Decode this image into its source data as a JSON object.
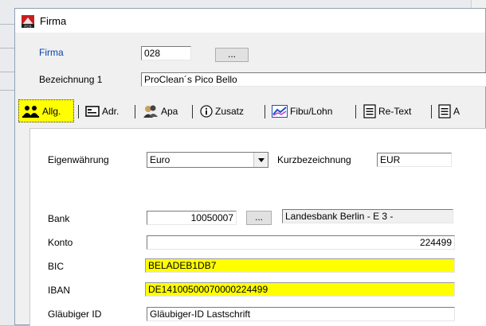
{
  "window": {
    "title": "Firma",
    "icon": "fcs-app-icon"
  },
  "header": {
    "firma_label": "Firma",
    "firma_value": "028",
    "lookup_button": "...",
    "bezeichnung_label": "Bezeichnung 1",
    "bezeichnung_value": "ProClean´s Pico Bello"
  },
  "tabs": [
    {
      "label": "Allg.",
      "icon": "people-icon",
      "active": true
    },
    {
      "label": "Adr.",
      "icon": "address-card-icon"
    },
    {
      "label": "Apa",
      "icon": "contacts-icon"
    },
    {
      "label": "Zusatz",
      "icon": "info-icon"
    },
    {
      "label": "Fibu/Lohn",
      "icon": "chart-icon"
    },
    {
      "label": "Re-Text",
      "icon": "document-icon"
    },
    {
      "label": "A",
      "icon": "document-icon"
    }
  ],
  "allg": {
    "eigenwaehrung_label": "Eigenwährung",
    "eigenwaehrung_value": "Euro",
    "kurzbezeichnung_label": "Kurzbezeichnung",
    "kurzbezeichnung_value": "EUR",
    "bank_label": "Bank",
    "bank_value": "10050007",
    "bank_lookup_button": "...",
    "bank_name": "Landesbank Berlin - E 3 -",
    "konto_label": "Konto",
    "konto_value": "224499",
    "bic_label": "BIC",
    "bic_value": "BELADEB1DB7",
    "iban_label": "IBAN",
    "iban_value": "DE14100500070000224499",
    "glaeubiger_label": "Gläubiger ID",
    "glaeubiger_value": "Gläubiger-ID Lastschrift"
  },
  "colors": {
    "highlight": "#ffff00",
    "link_blue": "#0645ad",
    "panel_bg": "#ffffff",
    "dialog_bg": "#f0f0f0"
  }
}
